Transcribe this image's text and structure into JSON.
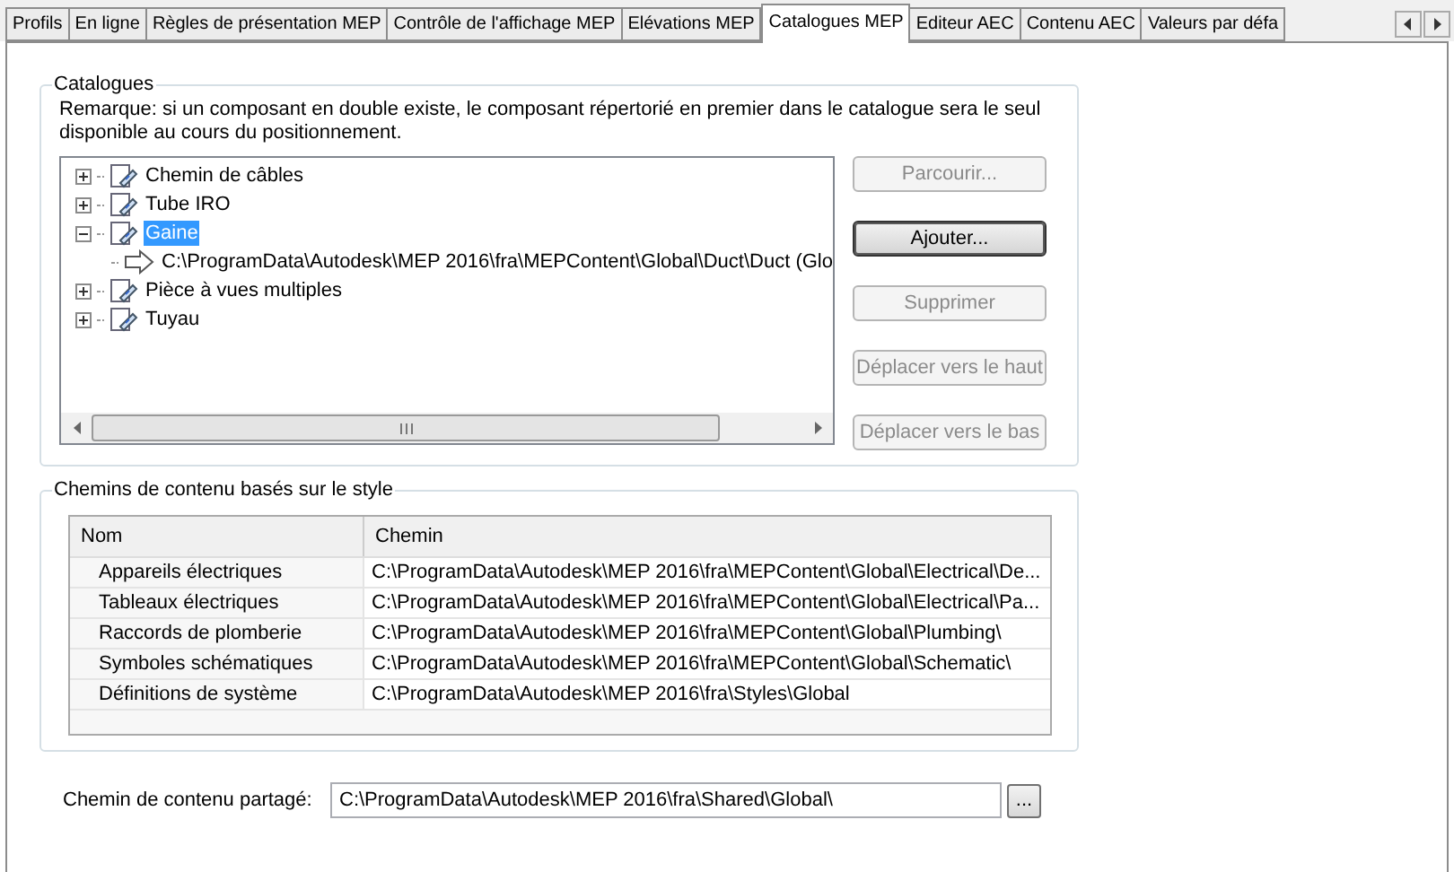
{
  "tabs": [
    {
      "label": "Profils",
      "selected": false
    },
    {
      "label": "En ligne",
      "selected": false
    },
    {
      "label": "Règles de présentation MEP",
      "selected": false
    },
    {
      "label": "Contrôle de l'affichage MEP",
      "selected": false
    },
    {
      "label": "Elévations MEP",
      "selected": false
    },
    {
      "label": "Catalogues MEP",
      "selected": true
    },
    {
      "label": "Editeur AEC",
      "selected": false
    },
    {
      "label": "Contenu AEC",
      "selected": false
    },
    {
      "label": "Valeurs par défa",
      "selected": false
    }
  ],
  "catalogues": {
    "title": "Catalogues",
    "note": "Remarque: si un composant en double existe, le composant répertorié en premier dans le catalogue sera le seul disponible au cours du positionnement.",
    "tree": [
      {
        "label": "Chemin de câbles",
        "expanded": false,
        "selected": false
      },
      {
        "label": "Tube IRO",
        "expanded": false,
        "selected": false
      },
      {
        "label": "Gaine",
        "expanded": true,
        "selected": true,
        "children": [
          {
            "label": "C:\\ProgramData\\Autodesk\\MEP 2016\\fra\\MEPContent\\Global\\Duct\\Duct (Glo",
            "selected": false
          }
        ]
      },
      {
        "label": "Pièce à vues multiples",
        "expanded": false,
        "selected": false
      },
      {
        "label": "Tuyau",
        "expanded": false,
        "selected": false
      }
    ],
    "buttons": [
      {
        "label": "Parcourir...",
        "disabled": true,
        "selected": false
      },
      {
        "label": "Ajouter...",
        "disabled": false,
        "selected": true
      },
      {
        "label": "Supprimer",
        "disabled": true,
        "selected": false
      },
      {
        "label": "Déplacer vers le haut",
        "disabled": true,
        "selected": false
      },
      {
        "label": "Déplacer vers le bas",
        "disabled": true,
        "selected": false
      }
    ]
  },
  "style_paths": {
    "title": "Chemins de contenu basés sur le style",
    "columns": [
      "Nom",
      "Chemin"
    ],
    "rows": [
      [
        "Appareils électriques",
        "C:\\ProgramData\\Autodesk\\MEP 2016\\fra\\MEPContent\\Global\\Electrical\\De..."
      ],
      [
        "Tableaux électriques",
        "C:\\ProgramData\\Autodesk\\MEP 2016\\fra\\MEPContent\\Global\\Electrical\\Pa..."
      ],
      [
        "Raccords de plomberie",
        "C:\\ProgramData\\Autodesk\\MEP 2016\\fra\\MEPContent\\Global\\Plumbing\\"
      ],
      [
        "Symboles schématiques",
        "C:\\ProgramData\\Autodesk\\MEP 2016\\fra\\MEPContent\\Global\\Schematic\\"
      ],
      [
        "Définitions de système",
        "C:\\ProgramData\\Autodesk\\MEP 2016\\fra\\Styles\\Global"
      ]
    ]
  },
  "shared": {
    "label": "Chemin de contenu partagé:",
    "value": "C:\\ProgramData\\Autodesk\\MEP 2016\\fra\\Shared\\Global\\",
    "browse": "..."
  }
}
